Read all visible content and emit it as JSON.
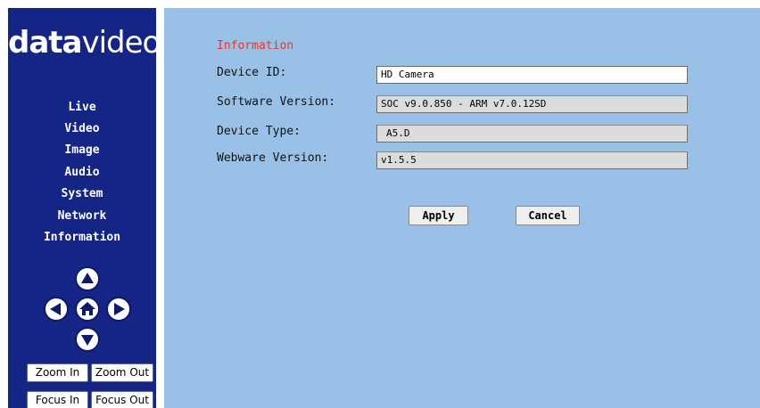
{
  "brand": {
    "logo_bold": "data",
    "logo_thin": "video"
  },
  "sidebar": {
    "items": [
      {
        "label": "Live"
      },
      {
        "label": "Video"
      },
      {
        "label": "Image"
      },
      {
        "label": "Audio"
      },
      {
        "label": "System"
      },
      {
        "label": "Network"
      },
      {
        "label": "Information"
      }
    ]
  },
  "ptz": {
    "up_icon": "arrow-up-icon",
    "left_icon": "arrow-left-icon",
    "home_icon": "home-icon",
    "right_icon": "arrow-right-icon",
    "down_icon": "arrow-down-icon",
    "zoom_in": "Zoom In",
    "zoom_out": "Zoom Out",
    "focus_in": "Focus In",
    "focus_out": "Focus Out"
  },
  "main": {
    "section_title": "Information",
    "fields": [
      {
        "label": "Device ID:",
        "value": "HD Camera",
        "editable": true
      },
      {
        "label": "Software Version:",
        "value": "SOC v9.0.850 - ARM v7.0.12SD",
        "editable": false
      },
      {
        "label": "Device Type:",
        "value": "A5.D",
        "editable": false
      },
      {
        "label": "Webware Version:",
        "value": "v1.5.5",
        "editable": false
      }
    ],
    "apply_label": "Apply",
    "cancel_label": "Cancel"
  },
  "colors": {
    "sidebar_bg": "#142586",
    "main_bg": "#99c1e8",
    "title_red": "#e63a2a"
  }
}
